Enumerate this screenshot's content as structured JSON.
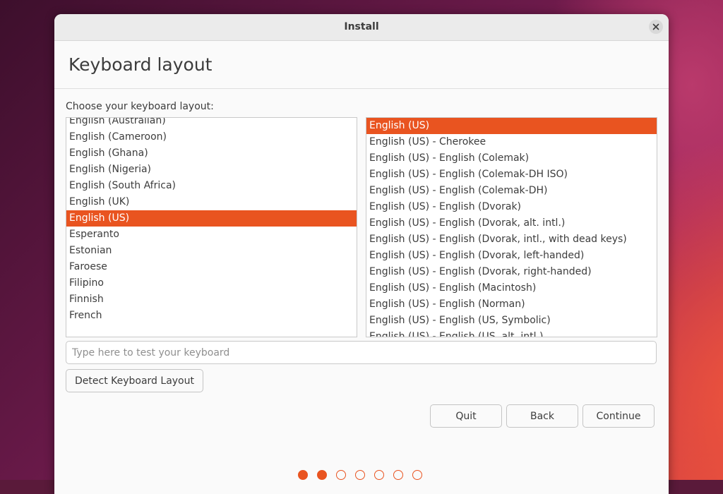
{
  "window": {
    "title": "Install"
  },
  "page": {
    "title": "Keyboard layout",
    "choose_label": "Choose your keyboard layout:"
  },
  "layouts": {
    "selected": "English (US)",
    "items": [
      "English (Australian)",
      "English (Cameroon)",
      "English (Ghana)",
      "English (Nigeria)",
      "English (South Africa)",
      "English (UK)",
      "English (US)",
      "Esperanto",
      "Estonian",
      "Faroese",
      "Filipino",
      "Finnish",
      "French"
    ]
  },
  "variants": {
    "selected": "English (US)",
    "items": [
      "English (US)",
      "English (US) - Cherokee",
      "English (US) - English (Colemak)",
      "English (US) - English (Colemak-DH ISO)",
      "English (US) - English (Colemak-DH)",
      "English (US) - English (Dvorak)",
      "English (US) - English (Dvorak, alt. intl.)",
      "English (US) - English (Dvorak, intl., with dead keys)",
      "English (US) - English (Dvorak, left-handed)",
      "English (US) - English (Dvorak, right-handed)",
      "English (US) - English (Macintosh)",
      "English (US) - English (Norman)",
      "English (US) - English (US, Symbolic)",
      "English (US) - English (US, alt. intl.)"
    ]
  },
  "test_input": {
    "placeholder": "Type here to test your keyboard",
    "value": ""
  },
  "buttons": {
    "detect": "Detect Keyboard Layout",
    "quit": "Quit",
    "back": "Back",
    "continue": "Continue"
  },
  "progress": {
    "total_steps": 7,
    "completed_steps": 2
  },
  "colors": {
    "accent": "#e95420",
    "window_bg": "#fafafa",
    "titlebar_bg": "#ebebeb"
  },
  "icons": {
    "close": "close-icon"
  }
}
